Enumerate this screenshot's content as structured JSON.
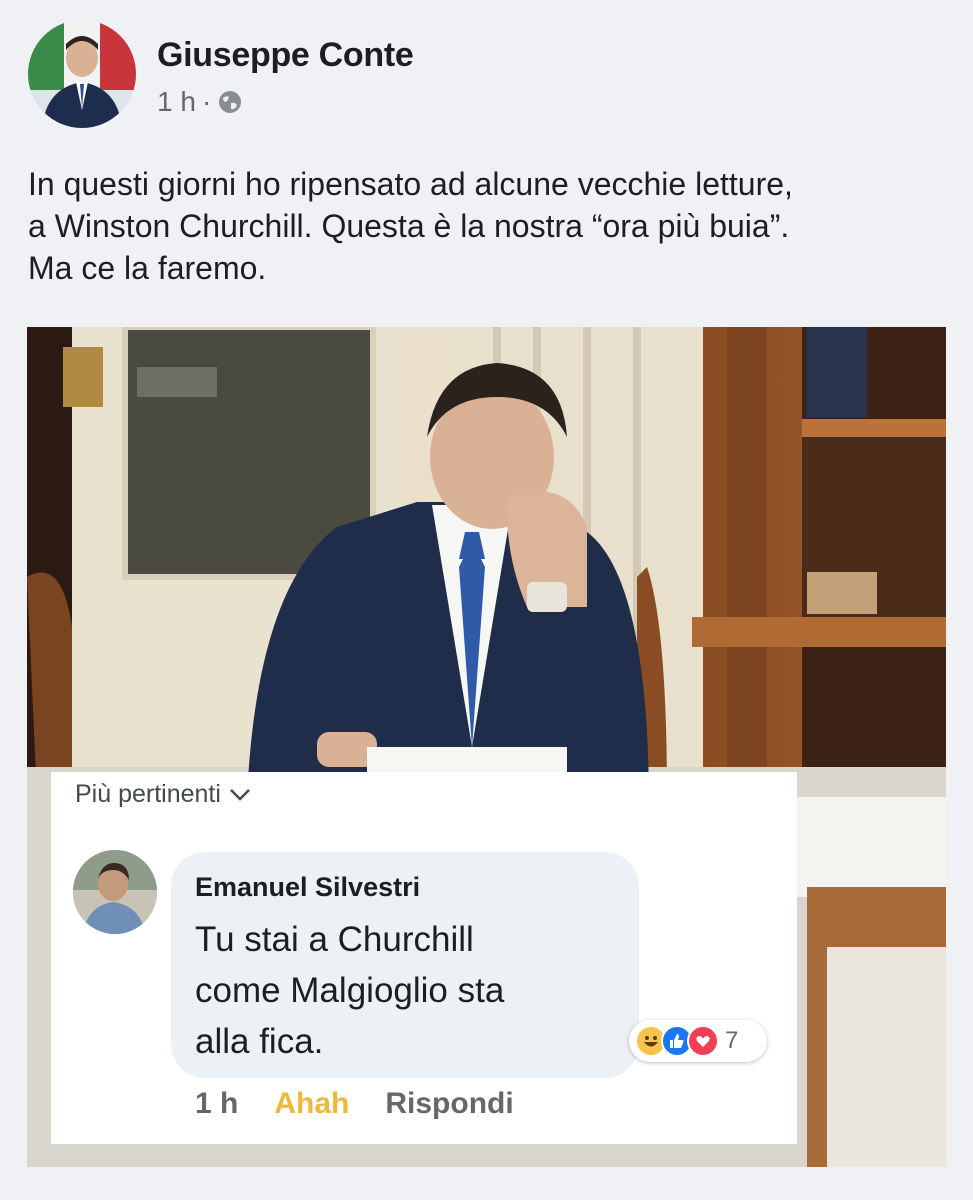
{
  "post": {
    "author": "Giuseppe Conte",
    "time": "1 h",
    "separator": "·",
    "privacy_icon": "globe-icon",
    "text_lines": [
      "In questi giorni ho ripensato ad alcune vecchie letture,",
      "a Winston Churchill. Questa è la nostra “ora più buia”.",
      "Ma ce la faremo."
    ]
  },
  "comments": {
    "sort_label": "Più pertinenti",
    "items": [
      {
        "author": "Emanuel Silvestri",
        "text_lines": [
          "Tu stai a Churchill",
          "come Malgioglio sta",
          "alla fica."
        ],
        "reactions": [
          "haha-icon",
          "like-icon",
          "love-icon"
        ],
        "reaction_count": "7",
        "time": "1 h",
        "my_reaction": "Ahah",
        "reply_label": "Rispondi"
      }
    ]
  },
  "colors": {
    "ahah": "#f0b83a",
    "like": "#1877f2",
    "love": "#f33e58"
  }
}
